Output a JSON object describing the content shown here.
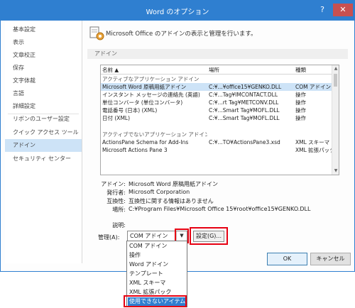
{
  "window": {
    "title": "Word のオプション",
    "help": "?",
    "close": "✕"
  },
  "sidebar": {
    "items": [
      {
        "label": "基本設定"
      },
      {
        "label": "表示"
      },
      {
        "label": "文章校正"
      },
      {
        "label": "保存"
      },
      {
        "label": "文字体裁"
      },
      {
        "label": "言語"
      },
      {
        "label": "詳細設定"
      },
      {
        "label": "リボンのユーザー設定"
      },
      {
        "label": "クイック アクセス ツール バー"
      },
      {
        "label": "アドイン"
      },
      {
        "label": "セキュリティ センター"
      }
    ],
    "active_index": 9
  },
  "main": {
    "header": "Microsoft Office のアドインの表示と管理を行います。",
    "section_title": "アドイン",
    "table": {
      "headers": {
        "name": "名前 ▲",
        "location": "場所",
        "type": "種類"
      },
      "group_active": "アクティブなアプリケーション アドイン",
      "active_rows": [
        {
          "name": "Microsoft Word 原稿用紙アドイン",
          "location": "C:¥...¥office15¥GENKO.DLL",
          "type": "COM アドイン"
        },
        {
          "name": "インスタント メッセージの連絡先 (英語)",
          "location": "C:¥...Tag¥IMCONTACT.DLL",
          "type": "操作"
        },
        {
          "name": "単位コンバータ (単位コンバータ)",
          "location": "C:¥...rt Tag¥METCONV.DLL",
          "type": "操作"
        },
        {
          "name": "電話番号 (日本) (XML)",
          "location": "C:¥...Smart Tag¥MOFL.DLL",
          "type": "操作"
        },
        {
          "name": "日付 (XML)",
          "location": "C:¥...Smart Tag¥MOFL.DLL",
          "type": "操作"
        }
      ],
      "group_inactive": "アクティブでないアプリケーション アドイン",
      "inactive_rows": [
        {
          "name": "ActionsPane Schema for Add-Ins",
          "location": "C:¥...TO¥ActionsPane3.xsd",
          "type": "XML スキーマ"
        },
        {
          "name": "Microsoft Actions Pane 3",
          "location": "",
          "type": "XML 拡張パック"
        }
      ]
    },
    "details": {
      "addin_label": "アドイン:",
      "addin_value": "Microsoft Word 原稿用紙アドイン",
      "publisher_label": "発行者:",
      "publisher_value": "Microsoft Corporation",
      "compat_label": "互換性:",
      "compat_value": "互換性に関する情報はありません",
      "location_label": "場所:",
      "location_value": "C:¥Program Files¥Microsoft Office 15¥root¥office15¥GENKO.DLL",
      "description_label": "説明:"
    },
    "manage": {
      "label": "管理(A):",
      "selected": "COM アドイン",
      "go_label": "設定(G)...",
      "options": [
        "COM アドイン",
        "操作",
        "Word アドイン",
        "テンプレート",
        "XML スキーマ",
        "XML 拡張パック",
        "使用できないアイテム"
      ],
      "highlighted_index": 6
    }
  },
  "footer": {
    "ok": "OK",
    "cancel": "キャンセル"
  },
  "colors": {
    "accent": "#2f7fd0",
    "highlight": "#e60012",
    "selection": "#cde3f7"
  }
}
